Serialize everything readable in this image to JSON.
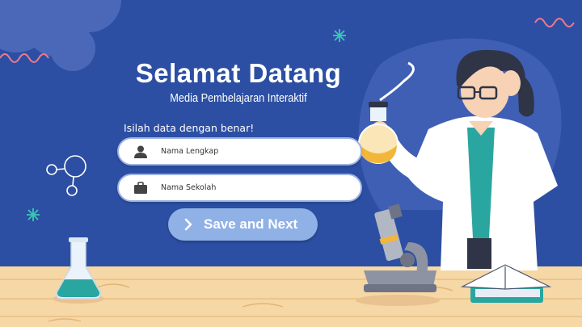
{
  "welcome": {
    "title": "Selamat Datang",
    "subtitle": "Media Pembelajaran Interaktif",
    "instruction": "Isilah data dengan benar!"
  },
  "form": {
    "name_placeholder": "Nama Lengkap",
    "name_icon": "person-icon",
    "school_placeholder": "Nama Sekolah",
    "school_icon": "briefcase-icon",
    "submit_label": "Save and Next",
    "submit_icon": "chevron-right-icon"
  },
  "colors": {
    "background": "#2c4fa3",
    "button": "#8fb1e6",
    "table": "#f6d7a6",
    "coat": "#ffffff",
    "accent": "#2aa6a0"
  }
}
